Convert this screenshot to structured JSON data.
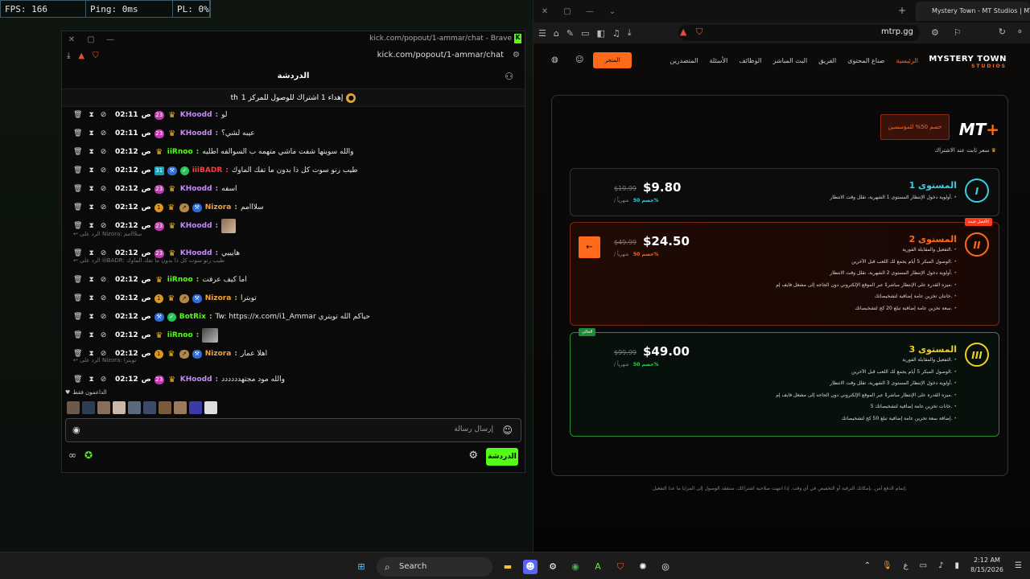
{
  "stats": {
    "fps": "FPS: 166",
    "ping": "Ping: 0ms",
    "pl": "PL: 0%"
  },
  "chat_window": {
    "title": "kick.com/popout/1-ammar/chat - Brave",
    "url": "kick.com/popout/1-ammar/chat",
    "header": "الدردشة",
    "pinned": "إهداء 1 اشتراك للوصول للمركز 1",
    "pinned_suffix": "th",
    "messages": [
      {
        "time": "02:11",
        "ampm": "ص",
        "sub": "23",
        "user": "KHoodd",
        "ucolor": "#c58af9",
        "text": "لو",
        "badges": [
          "sub",
          "crown"
        ]
      },
      {
        "time": "02:11",
        "ampm": "ص",
        "sub": "23",
        "user": "KHoodd",
        "ucolor": "#c58af9",
        "text": "عيبه لشي؟",
        "badges": [
          "sub",
          "crown"
        ]
      },
      {
        "time": "02:12",
        "ampm": "ص",
        "sub": "",
        "user": "iiRnoo",
        "ucolor": "#53fc18",
        "text": "والله سويتها شفت ماشي متهمه ب السوالفه اطليه",
        "badges": [
          "crown"
        ]
      },
      {
        "time": "02:12",
        "ampm": "ص",
        "sub": "31",
        "user": "iiiBADR",
        "ucolor": "#ff3b3b",
        "text": "طيب رنو سوت كل ذا بدون ما تفك الماوك",
        "badges": [
          "num",
          "blue",
          "green"
        ]
      },
      {
        "time": "02:12",
        "ampm": "ص",
        "sub": "23",
        "user": "KHoodd",
        "ucolor": "#c58af9",
        "text": "اسفه",
        "badges": [
          "sub",
          "crown"
        ]
      },
      {
        "time": "02:12",
        "ampm": "ص",
        "sub": "1",
        "user": "Nizora",
        "ucolor": "#f2a33a",
        "text": "سلااامم",
        "badges": [
          "gold",
          "crown",
          "og",
          "blue"
        ]
      },
      {
        "time": "02:12",
        "ampm": "ص",
        "sub": "23",
        "user": "KHoodd",
        "ucolor": "#c58af9",
        "text": "",
        "badges": [
          "sub",
          "crown"
        ],
        "emote": true
      },
      {
        "time": "02:12",
        "ampm": "ص",
        "sub": "23",
        "user": "KHoodd",
        "ucolor": "#c58af9",
        "text": "هايييي",
        "badges": [
          "sub",
          "crown"
        ]
      },
      {
        "time": "02:12",
        "ampm": "ص",
        "sub": "",
        "user": "iiRnoo",
        "ucolor": "#53fc18",
        "text": "اما كيف عرفت",
        "badges": [
          "crown"
        ]
      },
      {
        "time": "02:12",
        "ampm": "ص",
        "sub": "1",
        "user": "Nizora",
        "ucolor": "#f2a33a",
        "text": "توبترا",
        "badges": [
          "gold",
          "crown",
          "og",
          "blue"
        ]
      },
      {
        "time": "02:12",
        "ampm": "ص",
        "sub": "",
        "user": "BotRix",
        "ucolor": "#53fc18",
        "text": "Tw: https://x.com/i1_Ammar حياكم الله تويتري",
        "badges": [
          "blue",
          "green"
        ]
      },
      {
        "time": "02:12",
        "ampm": "ص",
        "sub": "",
        "user": "iiRnoo",
        "ucolor": "#53fc18",
        "text": "",
        "badges": [
          "crown"
        ],
        "emote2": true
      },
      {
        "time": "02:12",
        "ampm": "ص",
        "sub": "1",
        "user": "Nizora",
        "ucolor": "#f2a33a",
        "text": "اهلا عمار",
        "badges": [
          "gold",
          "crown",
          "og",
          "blue"
        ]
      },
      {
        "time": "02:12",
        "ampm": "ص",
        "sub": "23",
        "user": "KHoodd",
        "ucolor": "#c58af9",
        "text": "والله مود مجتهدددددد",
        "badges": [
          "sub",
          "crown"
        ]
      }
    ],
    "replies": [
      {
        "label": "الرد على Nizora: سلااامم"
      },
      {
        "label": "الرد على iiiBADR: طيب رنو سوت كل ذا بدون ما تفك الماوك"
      },
      {
        "label": "الرد على Nizora: توبترا"
      }
    ],
    "supporters_label": "الداعمون فقط",
    "input_placeholder": "إرسال رسالة",
    "send_label": "الدردشة"
  },
  "browser_right": {
    "tab_title": "Mystery Town - MT Studios | MT",
    "url": "mtrp.gg"
  },
  "site": {
    "logo": "MYSTERY TOWN",
    "logo_sub": "STUDIOS",
    "nav": [
      "الرئيسية",
      "صناع المحتوى",
      "الفريق",
      "البث المباشر",
      "الوظائف",
      "الأسئلة",
      "المتصدرين"
    ],
    "store": "المتجر",
    "mtplus": "MT+",
    "discount_badge": "خصم 50% للمؤسسين",
    "fixed_price": "سعر ثابت عند الاشتراك",
    "tiers": [
      {
        "name": "المستوى 1",
        "symbol": "I",
        "price": "$9.80",
        "old": "$19.99",
        "per": "/ شهرياً",
        "off": "خصم 50%",
        "bullets": [
          "أولوية دخول الإنتظار المستوى 1 الشهرية، تقلل وقت الانتظار."
        ]
      },
      {
        "name": "المستوى 2",
        "symbol": "II",
        "price": "$24.50",
        "old": "$49.99",
        "per": "/ شهرياً",
        "off": "خصم 50%",
        "tag": "الأفضل قيمة",
        "bullets": [
          "التفعيل والمقابلة الفورية.",
          "الوصول المبكر 5 أيام يجمع لك اللعب قبل الآخرين.",
          "أولوية دخول الإنتظار المستوى 2 الشهرية، تقلل وقت الانتظار.",
          "ميزه القدره على الإنتظار مباشرةً عبر الموقع الإلكتروني دون الحاجه إلى مشغل فايف إم.",
          "خانتان تخزين عامة إضافية لتشخيصاتك.",
          "سعة تخزين عامة إضافية تبلغ 20 كج لتشخيصاتك."
        ]
      },
      {
        "name": "المستوى 3",
        "symbol": "III",
        "price": "$49.00",
        "old": "$99.99",
        "per": "/ شهرياً",
        "off": "خصم 50%",
        "tag": "الحالي",
        "bullets": [
          "التفعيل والمقابلة الفورية.",
          "الوصول المبكر 5 أيام يجمع لك اللعب قبل الآخرين.",
          "أولوية دخول الإنتظار المستوى 3 الشهرية، تقلل وقت الانتظار.",
          "ميزه القدره على الإنتظار مباشرةً عبر الموقع الإلكتروني دون الحاجه إلى مشغل فايف إم.",
          "5 خانات تخزين عامة إضافية لتشخيصاتك.",
          "إضافة سعة تخزين عامة إضافية تبلغ 50 كج لتشخيصاتك."
        ]
      }
    ],
    "footer": "إتمام الدفع آمن. بإمكانك الترقية أو التخفيض في أي وقت. إذا انتهت صلاحية اشتراكك، ستفقد الوصول إلى المزايا ما عدا التفعيل."
  },
  "taskbar": {
    "search": "Search",
    "time": "2:12 AM",
    "date": "8/15/2026",
    "lang": "ع"
  }
}
